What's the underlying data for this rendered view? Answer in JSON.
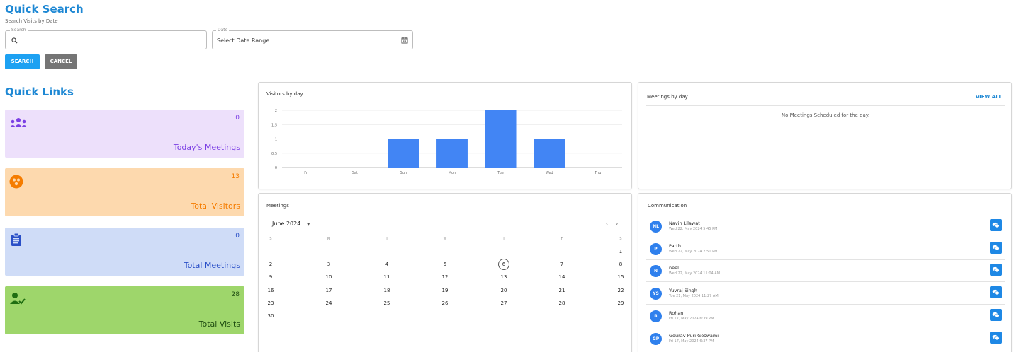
{
  "quick_search": {
    "title": "Quick Search",
    "subtitle": "Search Visits by Date",
    "search_label": "Search",
    "search_value": "",
    "date_label": "Date",
    "date_placeholder": "Select Date Range",
    "search_button": "SEARCH",
    "cancel_button": "CANCEL"
  },
  "quick_links": {
    "title": "Quick Links",
    "cards": [
      {
        "label": "Today's Meetings",
        "count": "0",
        "icon": "group-icon",
        "bg": "#ede0fb",
        "fg": "#7b3fe4"
      },
      {
        "label": "Total Visitors",
        "count": "13",
        "icon": "visitors-icon",
        "bg": "#fdd9ae",
        "fg": "#f57c00"
      },
      {
        "label": "Total Meetings",
        "count": "0",
        "icon": "clipboard-icon",
        "bg": "#cfdcf7",
        "fg": "#2a4fc7"
      },
      {
        "label": "Total Visits",
        "count": "28",
        "icon": "person-check-icon",
        "bg": "#9ed66b",
        "fg": "#1f6e12"
      }
    ]
  },
  "visitors_panel": {
    "title": "Visitors by day"
  },
  "chart_data": {
    "type": "bar",
    "title": "Visitors by day",
    "categories": [
      "Fri",
      "Sat",
      "Sun",
      "Mon",
      "Tue",
      "Wed",
      "Thu"
    ],
    "values": [
      0,
      0,
      1,
      1,
      2,
      1,
      0
    ],
    "y_ticks": [
      "0",
      "0.5",
      "1",
      "1.5",
      "2"
    ],
    "ylim": [
      0,
      2
    ],
    "grid": true,
    "bar_color": "#4285f4"
  },
  "meetings_by_day": {
    "title": "Meetings by day",
    "view_all": "VIEW ALL",
    "empty_text": "No Meetings Scheduled for the day."
  },
  "meetings_calendar": {
    "title": "Meetings",
    "month_label": "June 2024",
    "weekday_headers": [
      "S",
      "M",
      "T",
      "W",
      "T",
      "F",
      "S"
    ],
    "weeks": [
      [
        "",
        "",
        "",
        "",
        "",
        "",
        "1"
      ],
      [
        "2",
        "3",
        "4",
        "5",
        "6",
        "7",
        "8"
      ],
      [
        "9",
        "10",
        "11",
        "12",
        "13",
        "14",
        "15"
      ],
      [
        "16",
        "17",
        "18",
        "19",
        "20",
        "21",
        "22"
      ],
      [
        "23",
        "24",
        "25",
        "26",
        "27",
        "28",
        "29"
      ],
      [
        "30",
        "",
        "",
        "",
        "",
        "",
        ""
      ]
    ],
    "today": "6"
  },
  "communication": {
    "title": "Communication",
    "items": [
      {
        "initials": "NL",
        "name": "Navin Lilawat",
        "time": "Wed 22, May 2024 5:45 PM"
      },
      {
        "initials": "P",
        "name": "Parth",
        "time": "Wed 22, May 2024 2:51 PM"
      },
      {
        "initials": "N",
        "name": "neel",
        "time": "Wed 22, May 2024 11:04 AM"
      },
      {
        "initials": "YS",
        "name": "Yuvraj Singh",
        "time": "Tue 21, May 2024 11:27 AM"
      },
      {
        "initials": "R",
        "name": "Rohan",
        "time": "Fri 17, May 2024 6:39 PM"
      },
      {
        "initials": "GP",
        "name": "Gourav Puri Goswami",
        "time": "Fri 17, May 2024 6:37 PM"
      }
    ]
  },
  "colors": {
    "accent": "#1e88d4",
    "search_button": "#1da1f2",
    "cancel_button": "#757575",
    "avatar": "#2f80ed"
  }
}
